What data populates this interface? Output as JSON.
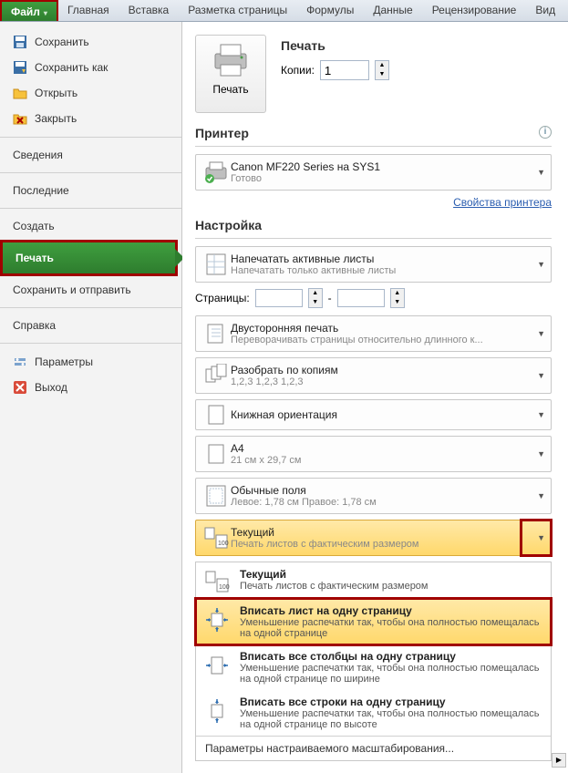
{
  "ribbon": {
    "file": "Файл",
    "tabs": [
      "Главная",
      "Вставка",
      "Разметка страницы",
      "Формулы",
      "Данные",
      "Рецензирование",
      "Вид"
    ]
  },
  "sidebar": {
    "save": "Сохранить",
    "saveAs": "Сохранить как",
    "open": "Открыть",
    "close": "Закрыть",
    "info": "Сведения",
    "recent": "Последние",
    "new": "Создать",
    "print": "Печать",
    "saveSend": "Сохранить и отправить",
    "help": "Справка",
    "options": "Параметры",
    "exit": "Выход"
  },
  "print": {
    "title": "Печать",
    "button": "Печать",
    "copiesLabel": "Копии:",
    "copies": "1"
  },
  "printer": {
    "title": "Принтер",
    "name": "Canon MF220 Series на SYS1",
    "status": "Готово",
    "propsLink": "Свойства принтера"
  },
  "settings": {
    "title": "Настройка",
    "active": {
      "t1": "Напечатать активные листы",
      "t2": "Напечатать только активные листы"
    },
    "pagesLabel": "Страницы:",
    "pagesDash": "-",
    "duplex": {
      "t1": "Двусторонняя печать",
      "t2": "Переворачивать страницы относительно длинного к..."
    },
    "collate": {
      "t1": "Разобрать по копиям",
      "t2": "1,2,3   1,2,3   1,2,3"
    },
    "orient": {
      "t1": "Книжная ориентация"
    },
    "paper": {
      "t1": "A4",
      "t2": "21 см x 29,7 см"
    },
    "margins": {
      "t1": "Обычные поля",
      "t2": "Левое: 1,78 см    Правое: 1,78 см"
    },
    "scaling": {
      "t1": "Текущий",
      "t2": "Печать листов с фактическим размером"
    }
  },
  "scalingMenu": {
    "items": [
      {
        "t1": "Текущий",
        "t2": "Печать листов с фактическим размером"
      },
      {
        "t1": "Вписать лист на одну страницу",
        "t2": "Уменьшение распечатки так, чтобы она полностью помещалась на одной странице"
      },
      {
        "t1": "Вписать все столбцы на одну страницу",
        "t2": "Уменьшение распечатки так, чтобы она полностью помещалась на одной странице по ширине"
      },
      {
        "t1": "Вписать все строки на одну страницу",
        "t2": "Уменьшение распечатки так, чтобы она полностью помещалась на одной странице по высоте"
      }
    ],
    "footer": "Параметры настраиваемого масштабирования..."
  }
}
